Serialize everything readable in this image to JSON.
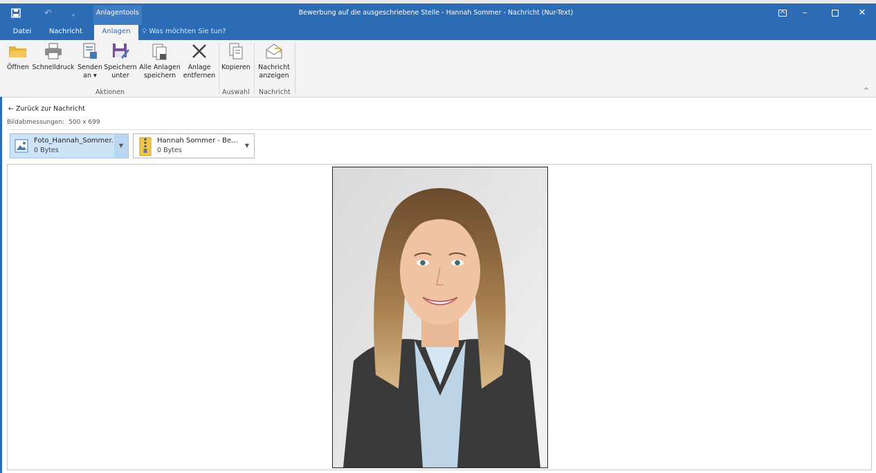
{
  "window": {
    "title": "Bewerbung auf die ausgeschriebene Stelle - Hannah Sommer - Nachricht (Nur-Text)",
    "context_label": "Anlagentools"
  },
  "tabs": [
    {
      "label": "Datei"
    },
    {
      "label": "Nachricht"
    },
    {
      "label": "Anlagen"
    }
  ],
  "tell_me": "Was möchten Sie tun?",
  "ribbon": {
    "buttons": [
      {
        "label": "Öffnen",
        "icon": "folder-open-icon"
      },
      {
        "label": "Schnelldruck",
        "icon": "printer-icon"
      },
      {
        "label": "Senden",
        "label2": "an ▾",
        "icon": "send-to-icon"
      },
      {
        "label": "Speichern",
        "label2": "unter",
        "icon": "save-as-icon"
      },
      {
        "label": "Alle Anlagen",
        "label2": "speichern",
        "icon": "save-all-attachments-icon"
      },
      {
        "label": "Anlage",
        "label2": "entfernen",
        "icon": "remove-attachment-icon"
      },
      {
        "label": "Kopieren",
        "icon": "copy-icon"
      },
      {
        "label": "Nachricht",
        "label2": "anzeigen",
        "icon": "show-message-icon"
      }
    ],
    "groups": [
      {
        "label": "Aktionen"
      },
      {
        "label": "Auswahl"
      },
      {
        "label": "Nachricht"
      }
    ]
  },
  "back_link": "Zurück zur Nachricht",
  "image_dimensions": {
    "label": "Bildabmessungen:",
    "value": "500 x 699"
  },
  "attachments": [
    {
      "name": "Foto_Hannah_Sommer...",
      "size": "0 Bytes",
      "icon": "image-file-icon",
      "selected": true
    },
    {
      "name": "Hannah Sommer - Be...",
      "size": "0 Bytes",
      "icon": "zip-file-icon",
      "selected": false
    }
  ],
  "colors": {
    "accent": "#2b6cb5",
    "ribbon_bg": "#f3f3f3",
    "selected_attachment": "#cde3f7"
  }
}
